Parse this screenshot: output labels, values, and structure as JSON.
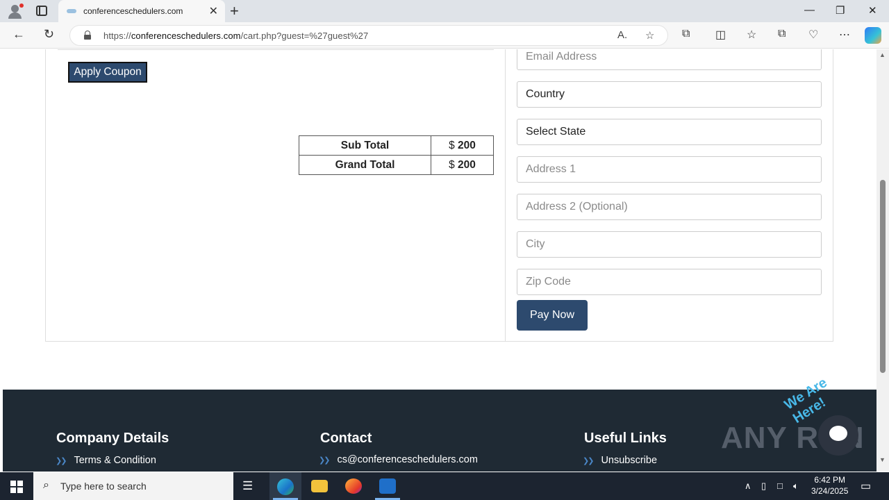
{
  "browser": {
    "tab_title": "conferenceschedulers.com",
    "tab_close": "✕",
    "new_tab": "+",
    "url_prefix": "https://",
    "url_domain": "conferenceschedulers.com",
    "url_path": "/cart.php?guest=%27guest%27",
    "window_controls": {
      "minimize": "—",
      "restore": "❐",
      "close": "✕"
    },
    "icons": [
      "back-icon",
      "refresh-icon",
      "read-aloud-icon",
      "favorite-icon",
      "extensions-icon",
      "split-screen-icon",
      "favorites-icon",
      "collections-icon",
      "performance-icon",
      "more-icon",
      "copilot-icon"
    ]
  },
  "cart": {
    "apply_coupon_label": "Apply Coupon",
    "totals": [
      {
        "label": "Sub Total",
        "currency": "$",
        "amount": "200"
      },
      {
        "label": "Grand Total",
        "currency": "$",
        "amount": "200"
      }
    ]
  },
  "checkout": {
    "fields": [
      {
        "name": "email",
        "placeholder": "Email Address",
        "value": ""
      },
      {
        "name": "country",
        "placeholder": "",
        "value": "Country"
      },
      {
        "name": "state",
        "placeholder": "",
        "value": "Select State"
      },
      {
        "name": "address1",
        "placeholder": "Address 1",
        "value": ""
      },
      {
        "name": "address2",
        "placeholder": "Address 2 (Optional)",
        "value": ""
      },
      {
        "name": "city",
        "placeholder": "City",
        "value": ""
      },
      {
        "name": "zip",
        "placeholder": "Zip Code",
        "value": ""
      }
    ],
    "pay_now_label": "Pay Now"
  },
  "footer": {
    "company": {
      "heading": "Company Details",
      "item": "Terms & Condition"
    },
    "contact": {
      "heading": "Contact",
      "item": "cs@conferenceschedulers.com"
    },
    "links": {
      "heading": "Useful Links",
      "item": "Unsubscribe"
    },
    "arrow": "❯❯"
  },
  "overlay": {
    "watermark": "ANY RUN",
    "chat_banner": "We Are Here!"
  },
  "taskbar": {
    "search_placeholder": "Type here to search",
    "time": "6:42 PM",
    "date": "3/24/2025"
  },
  "colors": {
    "accent": "#2d4a6e",
    "footer_bg": "#1f2a34",
    "taskbar_bg": "#1c2430"
  }
}
